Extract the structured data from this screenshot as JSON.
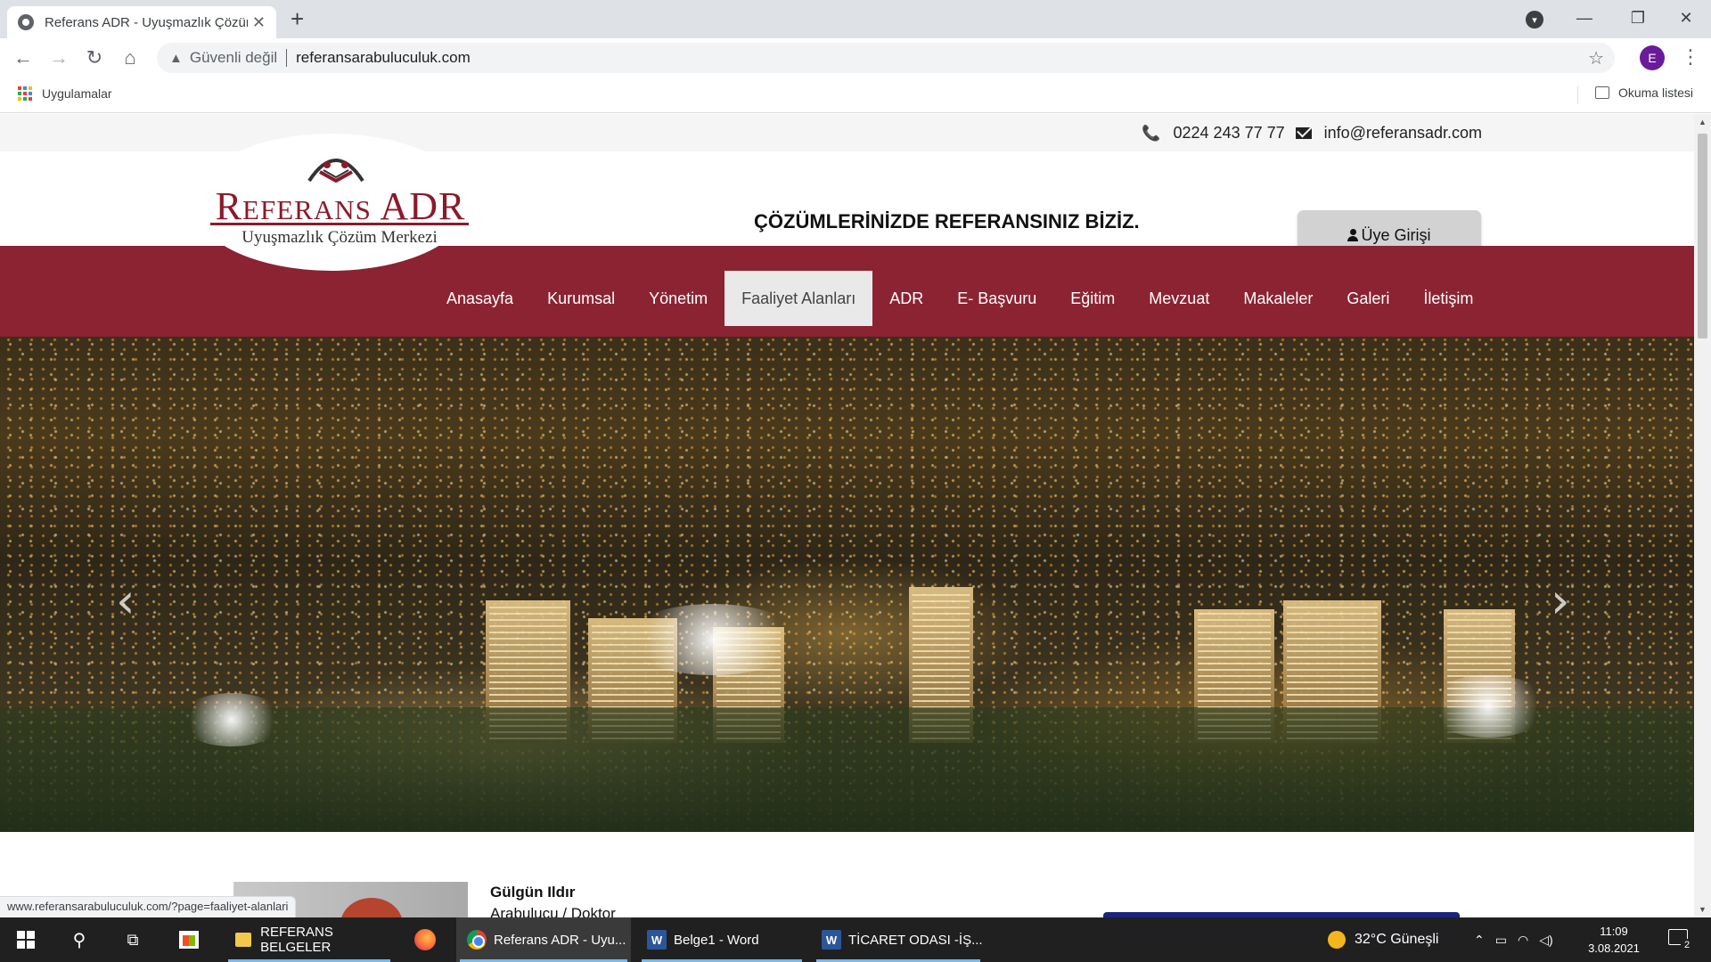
{
  "browser": {
    "tab_title": "Referans ADR - Uyuşmazlık Çözüm",
    "insecure_label": "Güvenli değil",
    "url": "referansarabuluculuk.com",
    "profile_initial": "E",
    "bookmarks": {
      "apps_label": "Uygulamalar",
      "reading_list_label": "Okuma listesi"
    },
    "status_url": "www.referansarabuluculuk.com/?page=faaliyet-alanlari"
  },
  "site": {
    "topbar": {
      "phone": "0224 243 77 77",
      "email": "info@referansadr.com"
    },
    "logo": {
      "name": "Referans ADR",
      "subtitle": "Uyuşmazlık Çözüm Merkezi"
    },
    "slogan": "ÇÖZÜMLERİNİZDE REFERANSINIZ BİZİZ.",
    "login_label": "Üye Girişi",
    "nav": [
      {
        "label": "Anasayfa",
        "active": false
      },
      {
        "label": "Kurumsal",
        "active": false
      },
      {
        "label": "Yönetim",
        "active": false
      },
      {
        "label": "Faaliyet Alanları",
        "active": true
      },
      {
        "label": "ADR",
        "active": false
      },
      {
        "label": "E- Başvuru",
        "active": false
      },
      {
        "label": "Eğitim",
        "active": false
      },
      {
        "label": "Mevzuat",
        "active": false
      },
      {
        "label": "Makaleler",
        "active": false
      },
      {
        "label": "Galeri",
        "active": false
      },
      {
        "label": "İletişim",
        "active": false
      }
    ],
    "hero": {
      "prev_icon": "chevron-left-icon",
      "next_icon": "chevron-right-icon"
    },
    "person": {
      "name": "Gülgün Ildır",
      "role": "Arabulucu / Doktor"
    }
  },
  "taskbar": {
    "items": [
      {
        "label": "REFERANS BELGELER",
        "icon": "folder-icon"
      },
      {
        "label": "Referans ADR - Uyu...",
        "icon": "chrome-icon"
      },
      {
        "label": "Belge1 - Word",
        "icon": "word-icon"
      },
      {
        "label": "TİCARET ODASI -İŞ...",
        "icon": "word-icon"
      }
    ],
    "weather": "32°C  Güneşli",
    "time": "11:09",
    "date": "3.08.2021",
    "notification_count": "2"
  },
  "colors": {
    "brand": "#8b2332",
    "nav_active_bg": "#e9e9e9",
    "login_bg": "#d2d2d2"
  }
}
